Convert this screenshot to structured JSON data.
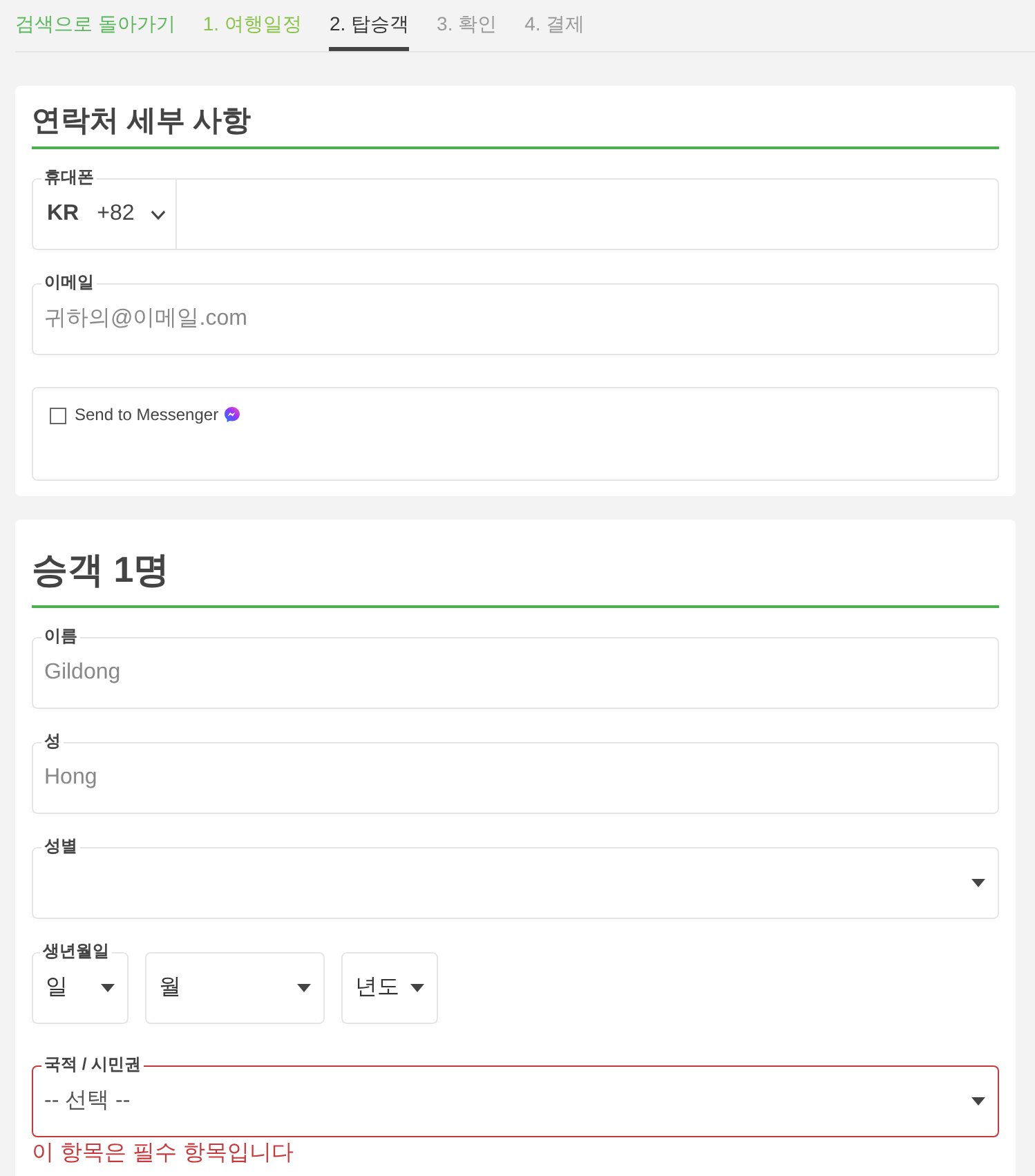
{
  "nav": {
    "back_link": "검색으로 돌아가기",
    "steps": [
      {
        "label": "1. 여행일정",
        "selected": false,
        "completed": true
      },
      {
        "label": "2. 탑승객",
        "selected": true,
        "completed": false
      },
      {
        "label": "3. 확인",
        "selected": false,
        "completed": false
      },
      {
        "label": "4. 결제",
        "selected": false,
        "completed": false
      }
    ]
  },
  "contact": {
    "title": "연락처 세부 사항",
    "phone": {
      "label": "휴대폰",
      "country": "KR",
      "dial_code": "+82"
    },
    "email": {
      "label": "이메일",
      "placeholder": "귀하의@이메일.com"
    },
    "messenger": {
      "label": "Send to Messenger",
      "checked": false
    }
  },
  "passenger": {
    "title": "승객 1명",
    "fields": [
      {
        "kind": "text",
        "label": "이름",
        "placeholder": "Gildong",
        "invalid": false
      },
      {
        "kind": "text",
        "label": "성",
        "placeholder": "Hong",
        "invalid": false
      },
      {
        "kind": "select",
        "label": "성별",
        "invalid": false
      },
      {
        "kind": "date",
        "label": "생년월일",
        "invalid": false,
        "parts": [
          "일",
          "월",
          "년도"
        ]
      },
      {
        "kind": "select",
        "label": "국적 / 시민권",
        "value": "-- 선택 --",
        "invalid": true,
        "error": "이 항목은 필수 항목입니다"
      }
    ]
  }
}
